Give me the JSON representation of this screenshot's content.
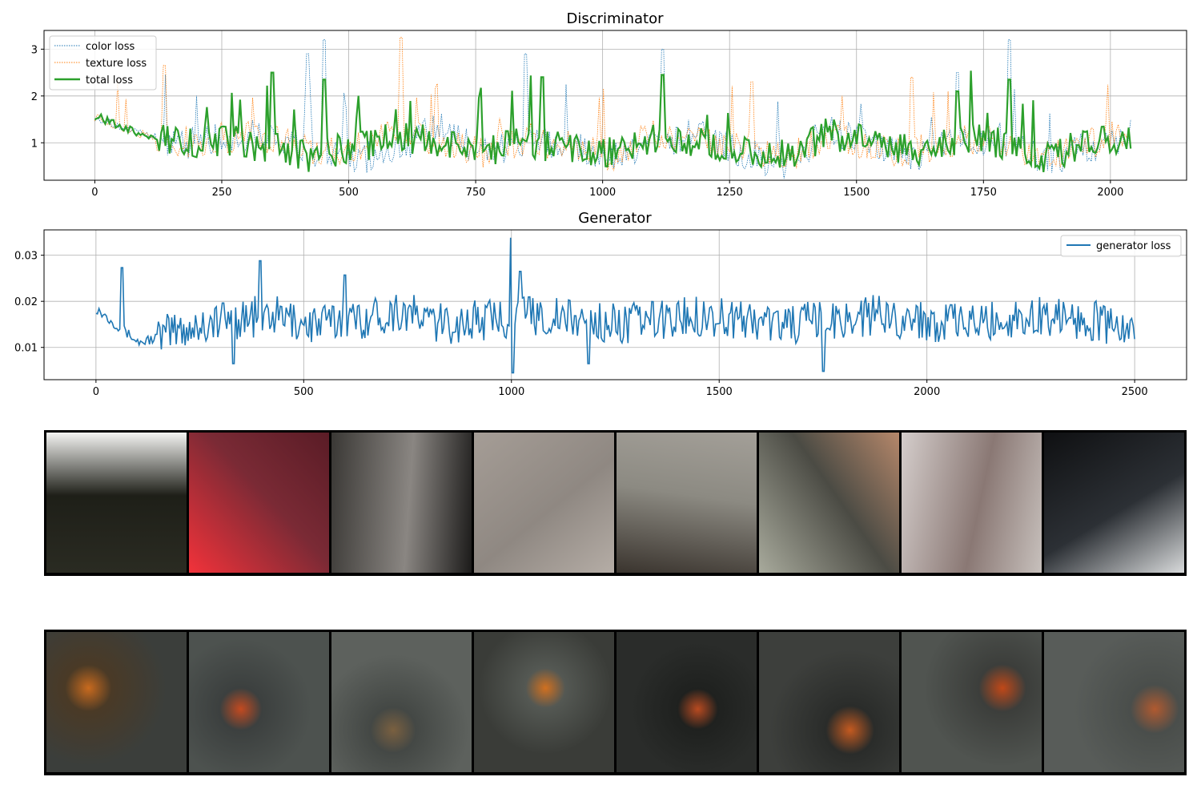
{
  "charts": [
    {
      "type": "line",
      "title": "Discriminator",
      "xlim": [
        -100,
        2150
      ],
      "ylim": [
        0.2,
        3.4
      ],
      "xticks": [
        0,
        250,
        500,
        750,
        1000,
        1250,
        1500,
        1750,
        2000
      ],
      "yticks": [
        1,
        2,
        3
      ],
      "grid": true,
      "legend_position": "top-left",
      "series": [
        {
          "name": "color loss",
          "color": "#1f77b4",
          "style": "dotted",
          "x_range": [
            0,
            2040
          ],
          "points": 500,
          "values_sample": [
            1.55,
            1.2,
            1.0,
            1.1,
            1.2,
            0.8,
            0.6,
            0.9,
            1.3,
            0.8,
            1.0,
            0.9,
            0.7,
            1.0,
            1.2,
            0.8,
            0.5,
            1.3,
            0.9,
            0.7,
            1.0,
            1.1,
            0.6,
            0.9,
            1.2
          ],
          "peaks": [
            [
              451,
              3.2
            ],
            [
              420,
              2.9
            ],
            [
              850,
              2.9
            ],
            [
              1118,
              3.0
            ],
            [
              1800,
              3.2
            ],
            [
              1700,
              2.5
            ]
          ]
        },
        {
          "name": "texture loss",
          "color": "#ff7f0e",
          "style": "dotted",
          "x_range": [
            0,
            2040
          ],
          "points": 500,
          "values_sample": [
            1.55,
            1.2,
            1.0,
            1.1,
            1.1,
            0.8,
            0.9,
            1.2,
            1.0,
            0.8,
            1.1,
            0.9,
            0.7,
            1.2,
            1.0,
            0.9,
            0.6,
            1.2,
            0.9,
            0.8,
            1.1,
            1.0,
            0.7,
            1.0,
            1.2
          ],
          "peaks": [
            [
              137,
              2.65
            ],
            [
              602,
              3.25
            ],
            [
              1293,
              2.3
            ],
            [
              1610,
              2.4
            ]
          ]
        },
        {
          "name": "total loss",
          "color": "#2ca02c",
          "style": "solid",
          "x_range": [
            0,
            2040
          ],
          "points": 500,
          "values_sample": [
            1.58,
            1.2,
            1.0,
            1.05,
            0.9,
            0.7,
            0.9,
            1.1,
            1.0,
            0.8,
            1.0,
            0.9,
            0.8,
            1.1,
            1.0,
            0.9,
            0.7,
            1.2,
            1.0,
            0.8,
            1.1,
            1.0,
            0.7,
            1.0,
            1.1
          ],
          "peaks": [
            [
              349,
              2.5
            ],
            [
              451,
              2.35
            ],
            [
              882,
              2.4
            ],
            [
              1118,
              2.45
            ],
            [
              1800,
              2.35
            ],
            [
              1700,
              2.1
            ]
          ]
        }
      ]
    },
    {
      "type": "line",
      "title": "Generator",
      "xlim": [
        -125,
        2625
      ],
      "ylim": [
        0.003,
        0.0355
      ],
      "xticks": [
        0,
        500,
        1000,
        1500,
        2000,
        2500
      ],
      "yticks": [
        0.01,
        0.02,
        0.03
      ],
      "grid": true,
      "legend_position": "top-right",
      "series": [
        {
          "name": "generator loss",
          "color": "#1f77b4",
          "style": "solid",
          "x_range": [
            0,
            2500
          ],
          "points": 700,
          "values_sample": [
            0.0185,
            0.011,
            0.014,
            0.016,
            0.017,
            0.015,
            0.016,
            0.018,
            0.015,
            0.016,
            0.017,
            0.016,
            0.015,
            0.016,
            0.017,
            0.016,
            0.015,
            0.016,
            0.017,
            0.016,
            0.015,
            0.016,
            0.017,
            0.016,
            0.013
          ],
          "peaks": [
            [
              62,
              0.0273
            ],
            [
              395,
              0.0288
            ],
            [
              1000,
              0.0338
            ],
            [
              1020,
              0.0265
            ],
            [
              600,
              0.0257
            ]
          ],
          "troughs": [
            [
              1002,
              0.0045
            ],
            [
              1750,
              0.0048
            ],
            [
              330,
              0.0065
            ],
            [
              1185,
              0.0065
            ]
          ]
        }
      ]
    }
  ],
  "image_rows": [
    {
      "tiles": [
        {
          "colors": [
            "#2a2b22",
            "#1e1f18",
            "#f4f4f2"
          ]
        },
        {
          "colors": [
            "#f2323a",
            "#7a2a35",
            "#5a1c26"
          ]
        },
        {
          "colors": [
            "#3a3835",
            "#8a8682",
            "#1c1b1a"
          ]
        },
        {
          "colors": [
            "#a59d96",
            "#8f8882",
            "#b5ada6"
          ]
        },
        {
          "colors": [
            "#3a342e",
            "#8c8a82",
            "#a39f98"
          ]
        },
        {
          "colors": [
            "#a8aa9c",
            "#4b4b44",
            "#b5876a"
          ]
        },
        {
          "colors": [
            "#d4cdcb",
            "#8a7874",
            "#c7c0bc"
          ]
        },
        {
          "colors": [
            "#0f1012",
            "#2c3035",
            "#d8dadb"
          ]
        }
      ]
    },
    {
      "tiles": [
        {
          "colors": [
            "#3b3e3b",
            "#4a3a26",
            "#c86a1e"
          ]
        },
        {
          "colors": [
            "#4d524f",
            "#3c403f",
            "#c34a20"
          ]
        },
        {
          "colors": [
            "#5d615d",
            "#444845",
            "#7a6040"
          ]
        },
        {
          "colors": [
            "#3a3c38",
            "#545853",
            "#d07020"
          ]
        },
        {
          "colors": [
            "#2a2c2a",
            "#1f211f",
            "#b84a20"
          ]
        },
        {
          "colors": [
            "#3d3f3c",
            "#2a2c2a",
            "#c45a20"
          ]
        },
        {
          "colors": [
            "#505450",
            "#3c3e3b",
            "#c04818"
          ]
        },
        {
          "colors": [
            "#585c59",
            "#4a4e4b",
            "#b05a30"
          ]
        }
      ]
    }
  ]
}
